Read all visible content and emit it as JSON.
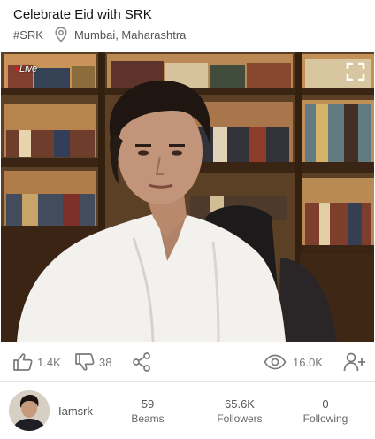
{
  "post": {
    "title": "Celebrate Eid with SRK",
    "hashtag": "#SRK",
    "location": "Mumbai, Maharashtra",
    "location_icon": "map-pin-icon"
  },
  "video": {
    "badge": "Live",
    "fullscreen_icon": "fullscreen-icon"
  },
  "actions": {
    "likes": "1.4K",
    "dislikes": "38",
    "views": "16.0K",
    "icons": [
      "thumbs-up-icon",
      "thumbs-down-icon",
      "share-icon",
      "eye-icon",
      "add-user-icon"
    ]
  },
  "profile": {
    "username": "Iamsrk",
    "beams": "59",
    "beams_label": "Beams",
    "followers": "65.6K",
    "followers_label": "Followers",
    "following": "0",
    "following_label": "Following"
  },
  "colors": {
    "text": "#222222",
    "muted": "#777777",
    "divider": "#e4e4e4"
  }
}
